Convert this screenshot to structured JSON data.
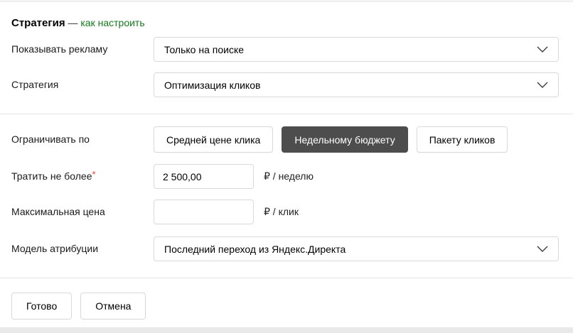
{
  "panel": {
    "title": "Стратегия",
    "title_dash": " — ",
    "title_link": "как настроить"
  },
  "form": {
    "show_ads": {
      "label": "Показывать рекламу",
      "value": "Только на поиске"
    },
    "strategy": {
      "label": "Стратегия",
      "value": "Оптимизация кликов"
    },
    "limit_by": {
      "label": "Ограничивать по",
      "options": [
        {
          "label": "Средней цене клика",
          "selected": false
        },
        {
          "label": "Недельному бюджету",
          "selected": true
        },
        {
          "label": "Пакету кликов",
          "selected": false
        }
      ]
    },
    "spend_limit": {
      "label": "Тратить не более",
      "required_mark": "*",
      "value": "2 500,00",
      "unit": "₽ / неделю"
    },
    "max_price": {
      "label": "Максимальная цена",
      "value": "",
      "unit": "₽ / клик"
    },
    "attribution": {
      "label": "Модель атрибуции",
      "value": "Последний переход из Яндекс.Директа"
    }
  },
  "actions": {
    "done": "Готово",
    "cancel": "Отмена"
  },
  "colors": {
    "link": "#137a1b",
    "toggle_selected_bg": "#4d4d4d",
    "toggle_selected_text": "#ffffff",
    "required": "#e53935",
    "control_border": "#d9d9d9",
    "divider": "#e5e5e5",
    "text": "#1a1a1a"
  }
}
